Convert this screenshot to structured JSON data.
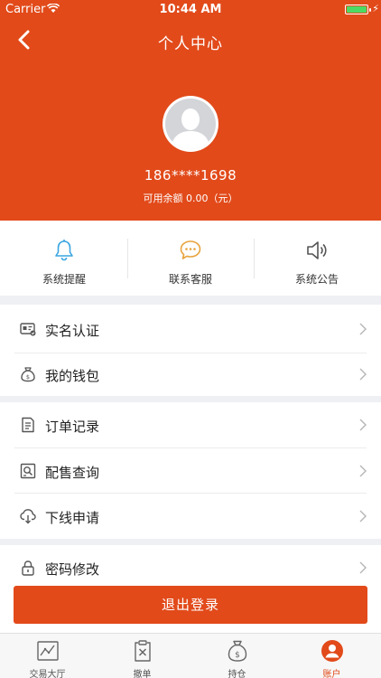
{
  "status": {
    "carrier": "Carrier",
    "time": "10:44 AM"
  },
  "nav": {
    "title": "个人中心"
  },
  "profile": {
    "phone": "186****1698",
    "balance": "可用余额 0.00（元）"
  },
  "quick_actions": [
    {
      "label": "系统提醒",
      "icon": "bell-icon"
    },
    {
      "label": "联系客服",
      "icon": "chat-bubble-icon"
    },
    {
      "label": "系统公告",
      "icon": "speaker-icon"
    }
  ],
  "menu": {
    "group1": [
      {
        "label": "实名认证",
        "icon": "id-card-icon"
      },
      {
        "label": "我的钱包",
        "icon": "wallet-icon"
      }
    ],
    "group2": [
      {
        "label": "订单记录",
        "icon": "document-icon"
      },
      {
        "label": "配售查询",
        "icon": "search-list-icon"
      },
      {
        "label": "下线申请",
        "icon": "cloud-download-icon"
      }
    ],
    "group3": [
      {
        "label": "密码修改",
        "icon": "lock-icon"
      }
    ]
  },
  "logout_label": "退出登录",
  "tabs": [
    {
      "label": "交易大厅",
      "icon": "chart-icon"
    },
    {
      "label": "撤单",
      "icon": "clipboard-cancel-icon"
    },
    {
      "label": "持仓",
      "icon": "money-bag-icon"
    },
    {
      "label": "账户",
      "icon": "user-icon",
      "active": true
    }
  ],
  "colors": {
    "accent": "#e24a1a",
    "battery": "#4cd964",
    "bell": "#3aa6e0",
    "chat": "#e8a33d"
  }
}
